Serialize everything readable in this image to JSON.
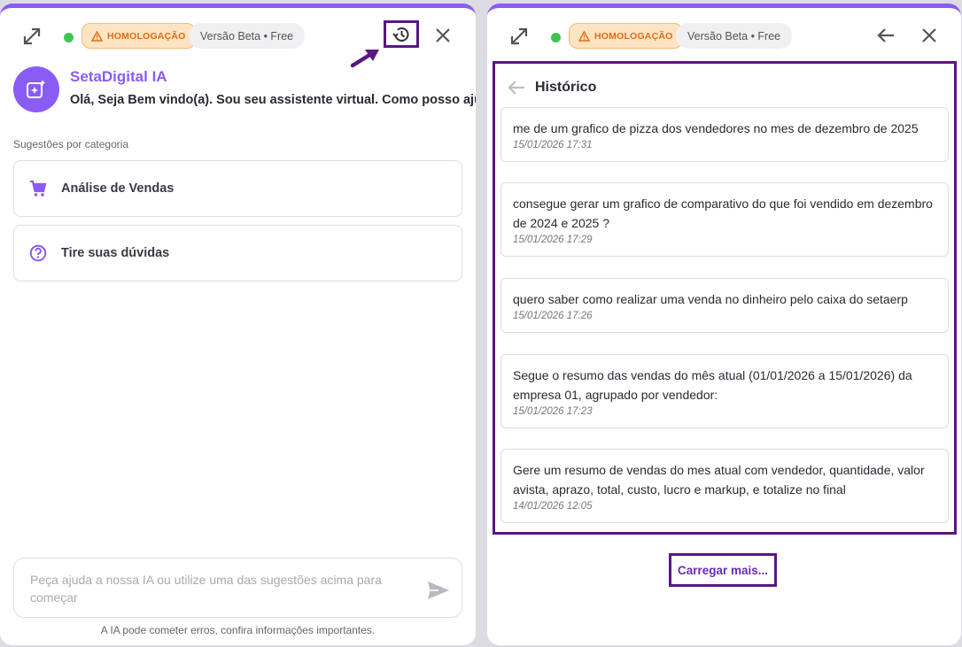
{
  "left_panel": {
    "badge_homolog": "HOMOLOGAÇÃO",
    "badge_version": "Versão Beta • Free",
    "bot_name": "SetaDigital IA",
    "greeting": "Olá, Seja Bem vindo(a). Sou seu assistente virtual. Como posso ajudar?",
    "suggestions_label": "Sugestões por categoria",
    "suggestions": [
      {
        "label": "Análise de Vendas",
        "icon": "cart-icon"
      },
      {
        "label": "Tire suas dúvidas",
        "icon": "question-circle-icon"
      }
    ],
    "input_placeholder": "Peça ajuda a nossa IA ou utilize uma das sugestões acima para começar",
    "disclaimer": "A IA pode cometer erros, confira informações importantes."
  },
  "right_panel": {
    "badge_homolog": "HOMOLOGAÇÃO",
    "badge_version": "Versão Beta • Free",
    "history_title": "Histórico",
    "history_items": [
      {
        "text": "me de um grafico de pizza dos vendedores no mes de dezembro de 2025",
        "time": "15/01/2026 17:31"
      },
      {
        "text": "consegue gerar um grafico de comparativo do que foi vendido em dezembro de 2024 e 2025 ?",
        "time": "15/01/2026 17:29"
      },
      {
        "text": "quero saber como realizar uma venda no dinheiro pelo caixa do setaerp",
        "time": "15/01/2026 17:26"
      },
      {
        "text": "Segue o resumo das vendas do mês atual (01/01/2026 a 15/01/2026) da empresa 01, agrupado por vendedor:",
        "time": "15/01/2026 17:23"
      },
      {
        "text": "Gere um resumo de vendas do mes atual com vendedor, quantidade, valor avista, aprazo, total, custo, lucro e markup, e totalize no final",
        "time": "14/01/2026 12:05"
      }
    ],
    "load_more": "Carregar mais..."
  },
  "colors": {
    "brand": "#8a5cf6",
    "highlight": "#5a1684",
    "status_online": "#3cc651",
    "warning_bg": "#fde4c2",
    "warning_text": "#e36b10"
  }
}
